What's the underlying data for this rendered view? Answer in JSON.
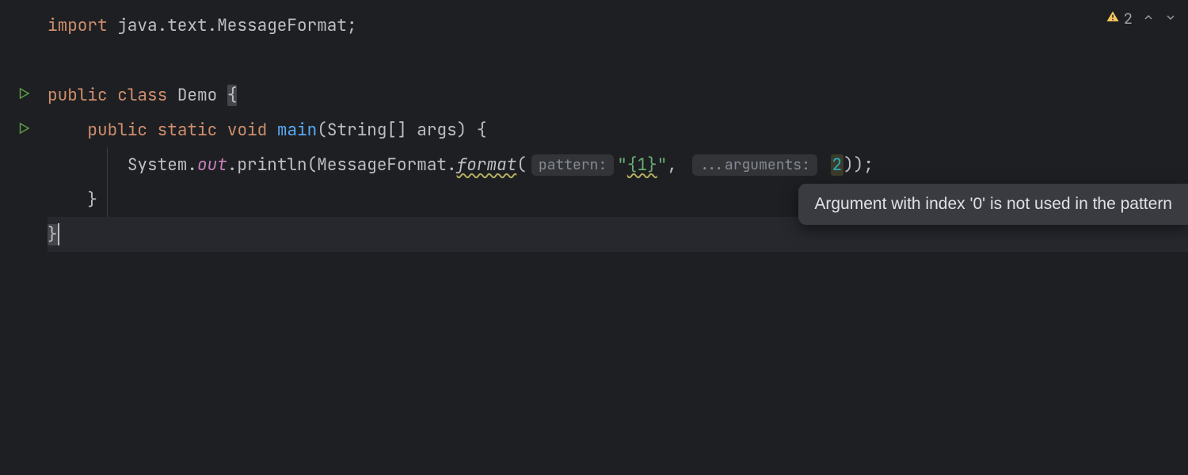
{
  "inspection": {
    "warning_count": "2"
  },
  "tooltip": {
    "text": "Argument with index '0' is not used in the pattern"
  },
  "code": {
    "line1": {
      "kw_import": "import",
      "pkg": " java.text.MessageFormat;"
    },
    "line3": {
      "kw_public": "public",
      "kw_class": "class",
      "class_name": "Demo",
      "brace": "{"
    },
    "line4": {
      "indent": "    ",
      "kw_public": "public",
      "kw_static": "static",
      "kw_void": "void",
      "method": "main",
      "params": "(String[] args) {"
    },
    "line5": {
      "indent": "        ",
      "sys": "System.",
      "out": "out",
      "dot_println": ".println(",
      "mf": "MessageFormat.",
      "format": "format",
      "open": "(",
      "hint_pattern": "pattern:",
      "str_open": "\"",
      "str_body": "{1}",
      "str_close": "\"",
      "comma": ", ",
      "hint_args": "...arguments:",
      "num": "2",
      "close": "));"
    },
    "line6": {
      "indent": "    ",
      "brace": "}"
    },
    "line7": {
      "brace": "}"
    }
  }
}
